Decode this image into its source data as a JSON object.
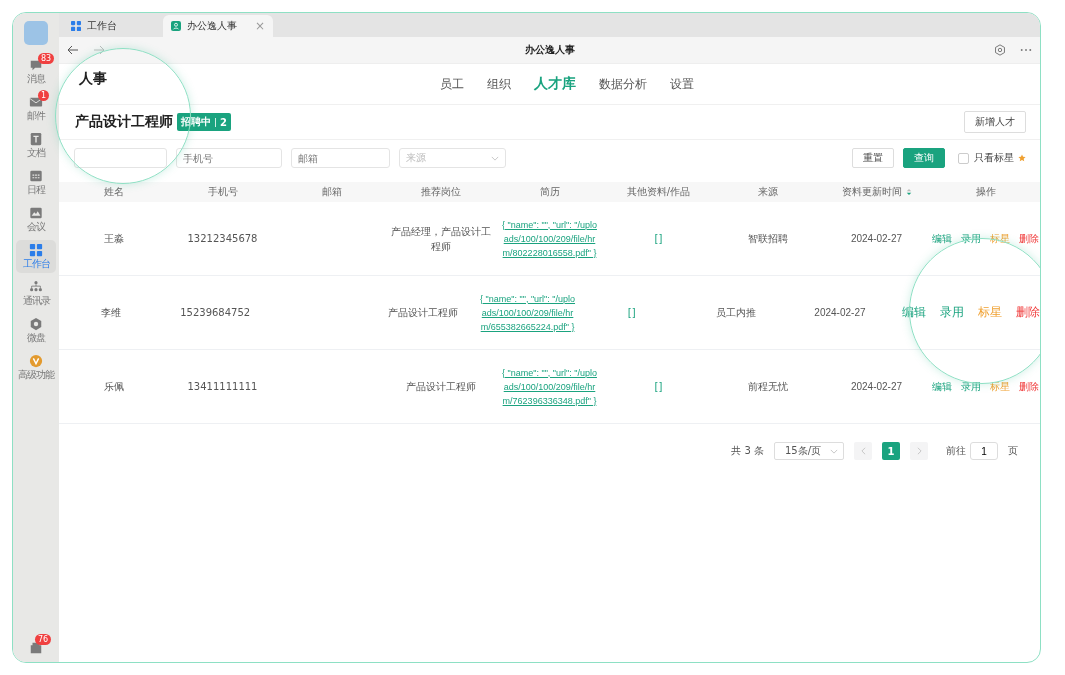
{
  "sidebar": {
    "items": [
      {
        "label": "消息",
        "kind": "chat",
        "badge": "83",
        "selected": false
      },
      {
        "label": "邮件",
        "kind": "mail",
        "badge": "1",
        "selected": false
      },
      {
        "label": "文档",
        "kind": "doc",
        "selected": false
      },
      {
        "label": "日程",
        "kind": "calendar",
        "selected": false
      },
      {
        "label": "会议",
        "kind": "meeting",
        "selected": false
      },
      {
        "label": "工作台",
        "kind": "grid",
        "selected": true
      },
      {
        "label": "通讯录",
        "kind": "org",
        "selected": false
      },
      {
        "label": "微盘",
        "kind": "disk",
        "selected": false
      },
      {
        "label": "高级功能",
        "kind": "premium",
        "selected": false
      }
    ],
    "bottom_badge": "76"
  },
  "tabs": [
    {
      "label": "工作台",
      "kind": "workbench",
      "selected": false
    },
    {
      "label": "办公逸人事",
      "kind": "app",
      "selected": true,
      "close": "×"
    }
  ],
  "toolbar": {
    "title": "办公逸人事"
  },
  "app_title": "人事",
  "nav": [
    {
      "label": "员工",
      "selected": false
    },
    {
      "label": "组织",
      "selected": false
    },
    {
      "label": "人才库",
      "selected": true
    },
    {
      "label": "数据分析",
      "selected": false
    },
    {
      "label": "设置",
      "selected": false
    }
  ],
  "job": {
    "title": "产品设计工程师",
    "status": "招聘中",
    "count": "2",
    "add_button": "新增人才"
  },
  "filters": {
    "fields": [
      {
        "kind": "input"
      },
      {
        "placeholder": "手机号",
        "kind": "input"
      },
      {
        "placeholder": "邮箱",
        "kind": "input"
      },
      {
        "placeholder": "来源",
        "kind": "select"
      }
    ],
    "reset": "重置",
    "search": "查询",
    "star_only": {
      "label": "只看标星",
      "checked": false
    }
  },
  "table": {
    "columns": [
      "姓名",
      "手机号",
      "邮箱",
      "推荐岗位",
      "简历",
      "其他资料/作品",
      "来源",
      "资料更新时间",
      "操作"
    ],
    "rows": [
      {
        "name": "王淼",
        "phone": "13212345678",
        "position": "产品经理，产品设计工程师",
        "resume": "{ \"name\": \"\", \"url\": \"/uploads/100/100/209/file/hrm/802228016558.pdf\" }",
        "other": "[]",
        "source": "智联招聘",
        "updated": "2024-02-27",
        "magnified": false,
        "actions": [
          {
            "label": "编辑",
            "kind": "edit"
          },
          {
            "label": "录用",
            "kind": "hire"
          },
          {
            "label": "标星",
            "kind": "star"
          },
          {
            "label": "删除",
            "kind": "delete"
          }
        ]
      },
      {
        "name": "李维",
        "phone": "15239684752",
        "position": "产品设计工程师",
        "resume": "{ \"name\": \"\", \"url\": \"/uploads/100/100/209/file/hrm/655382665224.pdf\" }",
        "other": "[]",
        "source": "员工内推",
        "updated": "2024-02-27",
        "magnified": true,
        "actions": [
          {
            "label": "编辑",
            "kind": "edit"
          },
          {
            "label": "录用",
            "kind": "hire"
          },
          {
            "label": "标星",
            "kind": "star"
          },
          {
            "label": "删除",
            "kind": "delete"
          }
        ]
      },
      {
        "name": "乐佩",
        "phone": "13411111111",
        "position": "产品设计工程师",
        "resume": "{ \"name\": \"\", \"url\": \"/uploads/100/100/209/file/hrm/762396336348.pdf\" }",
        "other": "[]",
        "source": "前程无忧",
        "updated": "2024-02-27",
        "magnified": false,
        "actions": [
          {
            "label": "编辑",
            "kind": "edit"
          },
          {
            "label": "录用",
            "kind": "hire"
          },
          {
            "label": "标星",
            "kind": "star"
          },
          {
            "label": "删除",
            "kind": "delete"
          }
        ]
      }
    ]
  },
  "pagination": {
    "total": "共 3 条",
    "page_size": "15条/页",
    "pages": [
      {
        "label": "1",
        "selected": true
      }
    ],
    "goto_label": "前往",
    "goto_value": "1",
    "page_unit": "页"
  }
}
